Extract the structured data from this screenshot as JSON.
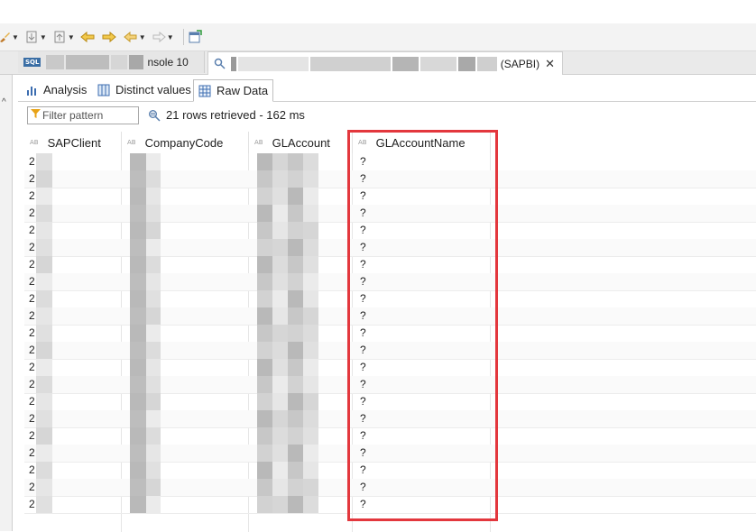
{
  "toolbar": {
    "icons": [
      "brush-icon",
      "import-icon",
      "export-icon",
      "back-icon",
      "forward-icon",
      "nav-back-icon",
      "nav-forward-icon",
      "open-editor-icon"
    ]
  },
  "editor_tabs": [
    {
      "badge": "SQL",
      "label": "nsole 10",
      "active": false
    },
    {
      "label": "(SAPBI)",
      "active": true,
      "close": "✕"
    }
  ],
  "sub_tabs": [
    {
      "label": "Analysis",
      "icon": "bar-chart-icon"
    },
    {
      "label": "Distinct values",
      "icon": "table-columns-icon"
    },
    {
      "label": "Raw Data",
      "icon": "grid-icon",
      "active": true
    }
  ],
  "filter": {
    "placeholder": "Filter pattern"
  },
  "status": {
    "text": "21 rows retrieved - 162 ms"
  },
  "grid": {
    "type_badge": "AB",
    "columns": [
      "SAPClient",
      "CompanyCode",
      "GLAccount",
      "GLAccountName"
    ],
    "rows": [
      {
        "client": "2",
        "name": "?"
      },
      {
        "client": "2",
        "name": "?"
      },
      {
        "client": "2",
        "name": "?"
      },
      {
        "client": "2",
        "name": "?"
      },
      {
        "client": "2",
        "name": "?"
      },
      {
        "client": "2",
        "name": "?"
      },
      {
        "client": "2",
        "name": "?"
      },
      {
        "client": "2",
        "name": "?"
      },
      {
        "client": "2",
        "name": "?"
      },
      {
        "client": "2",
        "name": "?"
      },
      {
        "client": "2",
        "name": "?"
      },
      {
        "client": "2",
        "name": "?"
      },
      {
        "client": "2",
        "name": "?"
      },
      {
        "client": "2",
        "name": "?"
      },
      {
        "client": "2",
        "name": "?"
      },
      {
        "client": "2",
        "name": "?"
      },
      {
        "client": "2",
        "name": "?"
      },
      {
        "client": "2",
        "name": "?"
      },
      {
        "client": "2",
        "name": "?"
      },
      {
        "client": "2",
        "name": "?"
      },
      {
        "client": "2",
        "name": "?"
      }
    ]
  },
  "colors": {
    "highlight": "#e3373d",
    "funnel": "#e8a317",
    "sql_badge": "#3a6ea5"
  }
}
